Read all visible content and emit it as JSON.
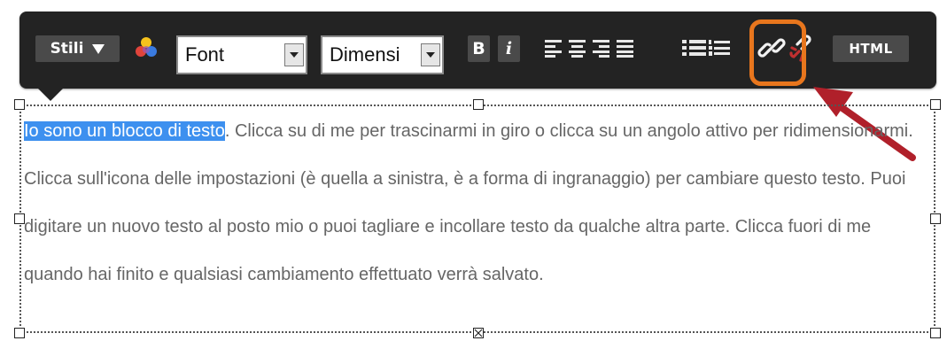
{
  "toolbar": {
    "styles_label": "Stili",
    "font_value": "Font",
    "size_value": "Dimensi",
    "bold_label": "B",
    "italic_label": "i",
    "html_label": "HTML"
  },
  "text_block": {
    "highlighted": "Io sono un blocco di testo",
    "rest": ". Clicca su di me per trascinarmi in giro o clicca su un angolo attivo per ridimensionarmi. Clicca sull'icona delle impostazioni (è quella a sinistra, è a forma di ingranaggio) per cambiare questo testo. Puoi digitare un nuovo testo al posto mio o puoi tagliare e incollare testo da qualche altra parte. Clicca fuori di me quando hai finito e qualsiasi cambiamento effettuato verrà salvato."
  },
  "colors": {
    "toolbar_bg": "#232323",
    "highlight_ring": "#e8761d",
    "annotation_arrow": "#b0202a",
    "selection": "#3d90ef"
  },
  "icons": [
    "caret-down-icon",
    "color-palette-icon",
    "dropdown-arrow-icon",
    "align-left-icon",
    "align-center-icon",
    "align-right-icon",
    "align-justify-icon",
    "bullet-list-icon",
    "numbered-list-icon",
    "link-icon",
    "unlink-icon",
    "resize-handle-icon"
  ]
}
